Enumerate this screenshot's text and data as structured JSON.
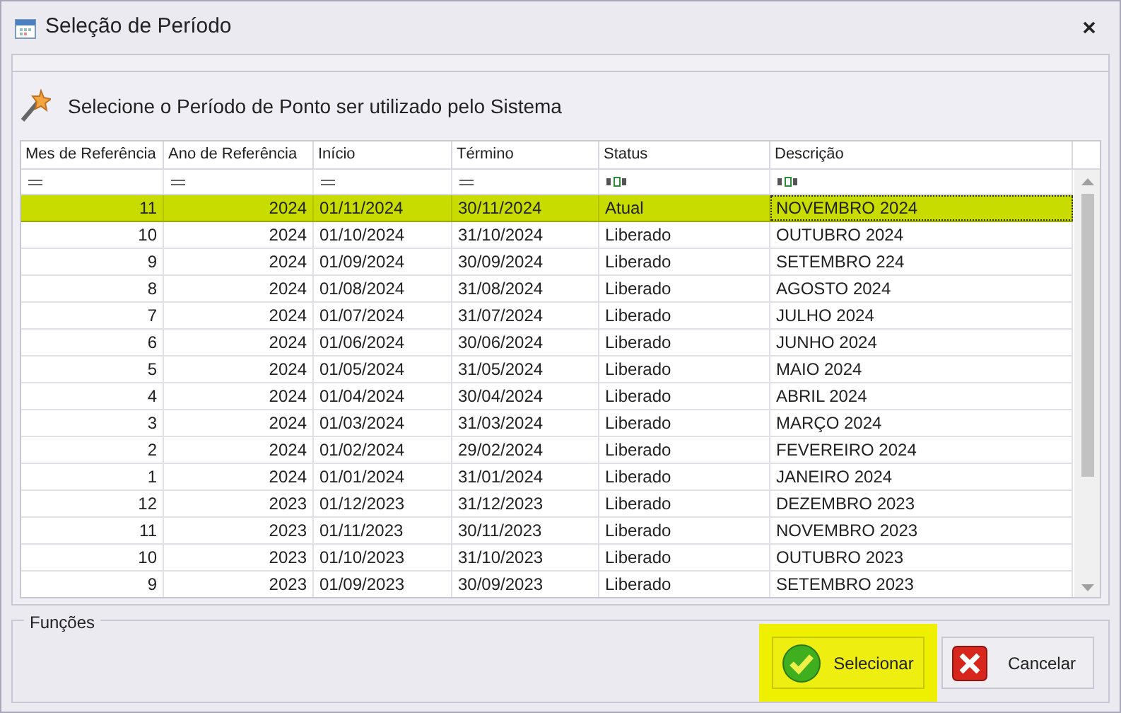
{
  "window": {
    "title": "Seleção de Período"
  },
  "heading": "Selecione o Período de Ponto ser utilizado pelo Sistema",
  "table": {
    "columns": [
      {
        "label": "Mes de Referência",
        "kind": "number"
      },
      {
        "label": "Ano de Referência",
        "kind": "number"
      },
      {
        "label": "Início",
        "kind": "date"
      },
      {
        "label": "Término",
        "kind": "date"
      },
      {
        "label": "Status",
        "kind": "text"
      },
      {
        "label": "Descrição",
        "kind": "text"
      }
    ],
    "rows": [
      {
        "selected": true,
        "cells": [
          "11",
          "2024",
          "01/11/2024",
          "30/11/2024",
          "Atual",
          "NOVEMBRO 2024"
        ]
      },
      {
        "selected": false,
        "cells": [
          "10",
          "2024",
          "01/10/2024",
          "31/10/2024",
          "Liberado",
          "OUTUBRO 2024"
        ]
      },
      {
        "selected": false,
        "cells": [
          "9",
          "2024",
          "01/09/2024",
          "30/09/2024",
          "Liberado",
          "SETEMBRO 224"
        ]
      },
      {
        "selected": false,
        "cells": [
          "8",
          "2024",
          "01/08/2024",
          "31/08/2024",
          "Liberado",
          "AGOSTO 2024"
        ]
      },
      {
        "selected": false,
        "cells": [
          "7",
          "2024",
          "01/07/2024",
          "31/07/2024",
          "Liberado",
          "JULHO 2024"
        ]
      },
      {
        "selected": false,
        "cells": [
          "6",
          "2024",
          "01/06/2024",
          "30/06/2024",
          "Liberado",
          "JUNHO 2024"
        ]
      },
      {
        "selected": false,
        "cells": [
          "5",
          "2024",
          "01/05/2024",
          "31/05/2024",
          "Liberado",
          "MAIO 2024"
        ]
      },
      {
        "selected": false,
        "cells": [
          "4",
          "2024",
          "01/04/2024",
          "30/04/2024",
          "Liberado",
          "ABRIL 2024"
        ]
      },
      {
        "selected": false,
        "cells": [
          "3",
          "2024",
          "01/03/2024",
          "31/03/2024",
          "Liberado",
          "MARÇO 2024"
        ]
      },
      {
        "selected": false,
        "cells": [
          "2",
          "2024",
          "01/02/2024",
          "29/02/2024",
          "Liberado",
          "FEVEREIRO 2024"
        ]
      },
      {
        "selected": false,
        "cells": [
          "1",
          "2024",
          "01/01/2024",
          "31/01/2024",
          "Liberado",
          "JANEIRO 2024"
        ]
      },
      {
        "selected": false,
        "cells": [
          "12",
          "2023",
          "01/12/2023",
          "31/12/2023",
          "Liberado",
          "DEZEMBRO 2023"
        ]
      },
      {
        "selected": false,
        "cells": [
          "11",
          "2023",
          "01/11/2023",
          "30/11/2023",
          "Liberado",
          "NOVEMBRO 2023"
        ]
      },
      {
        "selected": false,
        "cells": [
          "10",
          "2023",
          "01/10/2023",
          "31/10/2023",
          "Liberado",
          "OUTUBRO 2023"
        ]
      },
      {
        "selected": false,
        "cells": [
          "9",
          "2023",
          "01/09/2023",
          "30/09/2023",
          "Liberado",
          "SETEMBRO 2023"
        ]
      }
    ]
  },
  "footer": {
    "group_label": "Funções",
    "buttons": [
      {
        "label": "Selecionar",
        "kind": "confirm",
        "highlighted": true
      },
      {
        "label": "Cancelar",
        "kind": "cancel",
        "highlighted": false
      }
    ]
  }
}
